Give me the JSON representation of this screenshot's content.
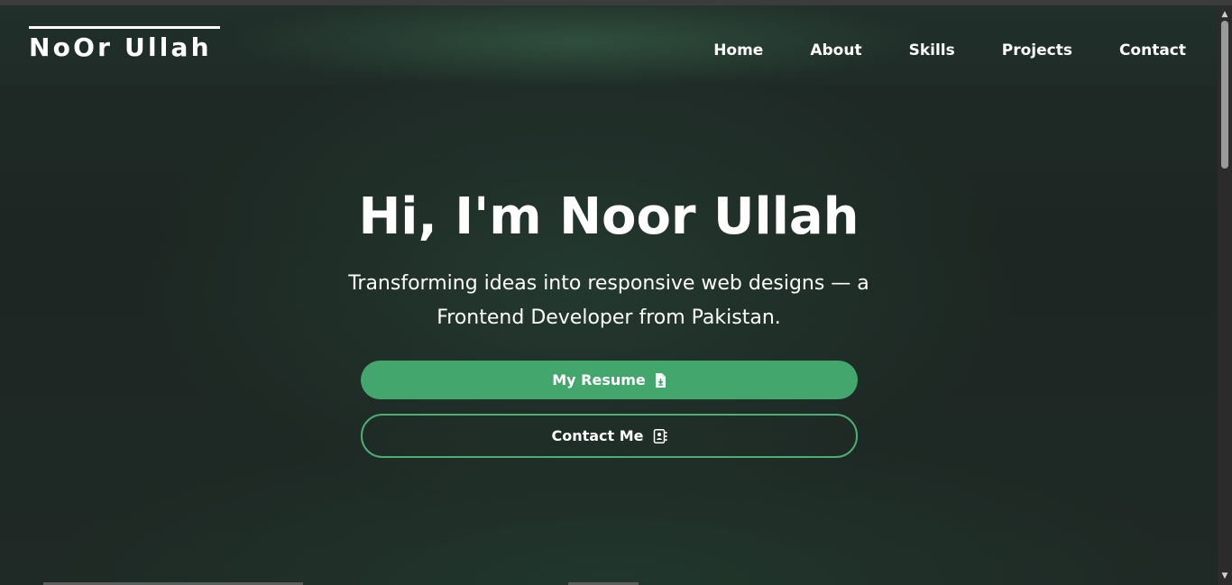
{
  "brand": {
    "logo_text": "NoOr Ullah"
  },
  "nav": {
    "items": [
      {
        "label": "Home"
      },
      {
        "label": "About"
      },
      {
        "label": "Skills"
      },
      {
        "label": "Projects"
      },
      {
        "label": "Contact"
      }
    ]
  },
  "hero": {
    "title": "Hi, I'm Noor Ullah",
    "subtitle": "Transforming ideas into responsive web designs — a Frontend Developer from Pakistan.",
    "resume_button": {
      "label": "My Resume",
      "icon": "file-download-icon"
    },
    "contact_button": {
      "label": "Contact Me",
      "icon": "contact-book-icon"
    }
  },
  "colors": {
    "accent": "#43a66c",
    "background": "#1d2622",
    "text": "#ffffff"
  }
}
